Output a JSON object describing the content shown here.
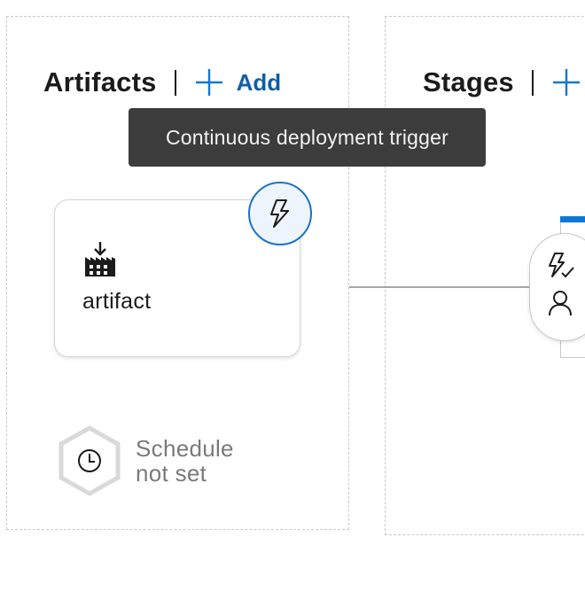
{
  "artifacts": {
    "title": "Artifacts",
    "add_label": "Add",
    "card": {
      "name": "artifact",
      "trigger_tooltip": "Continuous deployment trigger"
    },
    "schedule": {
      "line1": "Schedule",
      "line2": "not set"
    }
  },
  "stages": {
    "title": "Stages"
  },
  "icons": {
    "add": "plus-icon",
    "artifact": "build-artifact-icon",
    "trigger": "lightning-icon",
    "pre_deploy_trigger": "lightning-check-icon",
    "approvers": "person-icon",
    "schedule": "clock-icon"
  },
  "colors": {
    "accent": "#0f78d4",
    "link": "#0f5ea8",
    "tooltip_bg": "#3c3c3c",
    "text_dark": "#1b1b1b",
    "text_muted": "#7a7a7a"
  }
}
